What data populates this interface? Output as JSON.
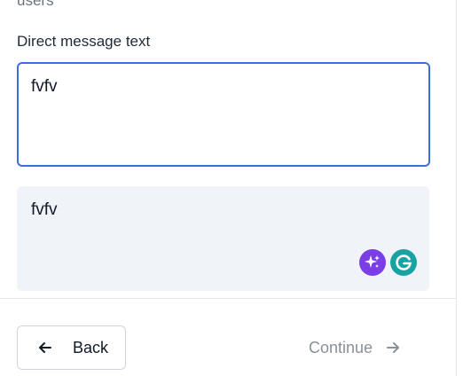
{
  "header": {
    "clipped_text": "users"
  },
  "form": {
    "field_label": "Direct message text",
    "message_value": "fvfv"
  },
  "preview": {
    "text": "fvfv",
    "sparkle_icon": "sparkle-icon",
    "grammar_icon": "grammarly-g-icon"
  },
  "footer": {
    "back_label": "Back",
    "continue_label": "Continue",
    "back_icon": "arrow-left-icon",
    "continue_icon": "arrow-right-icon"
  },
  "colors": {
    "focus_border": "#3b6fd8",
    "preview_bg": "#f0f3f7",
    "sparkle": "#7a3de6",
    "grammar": "#17a2a4",
    "disabled_text": "#8a9099"
  }
}
